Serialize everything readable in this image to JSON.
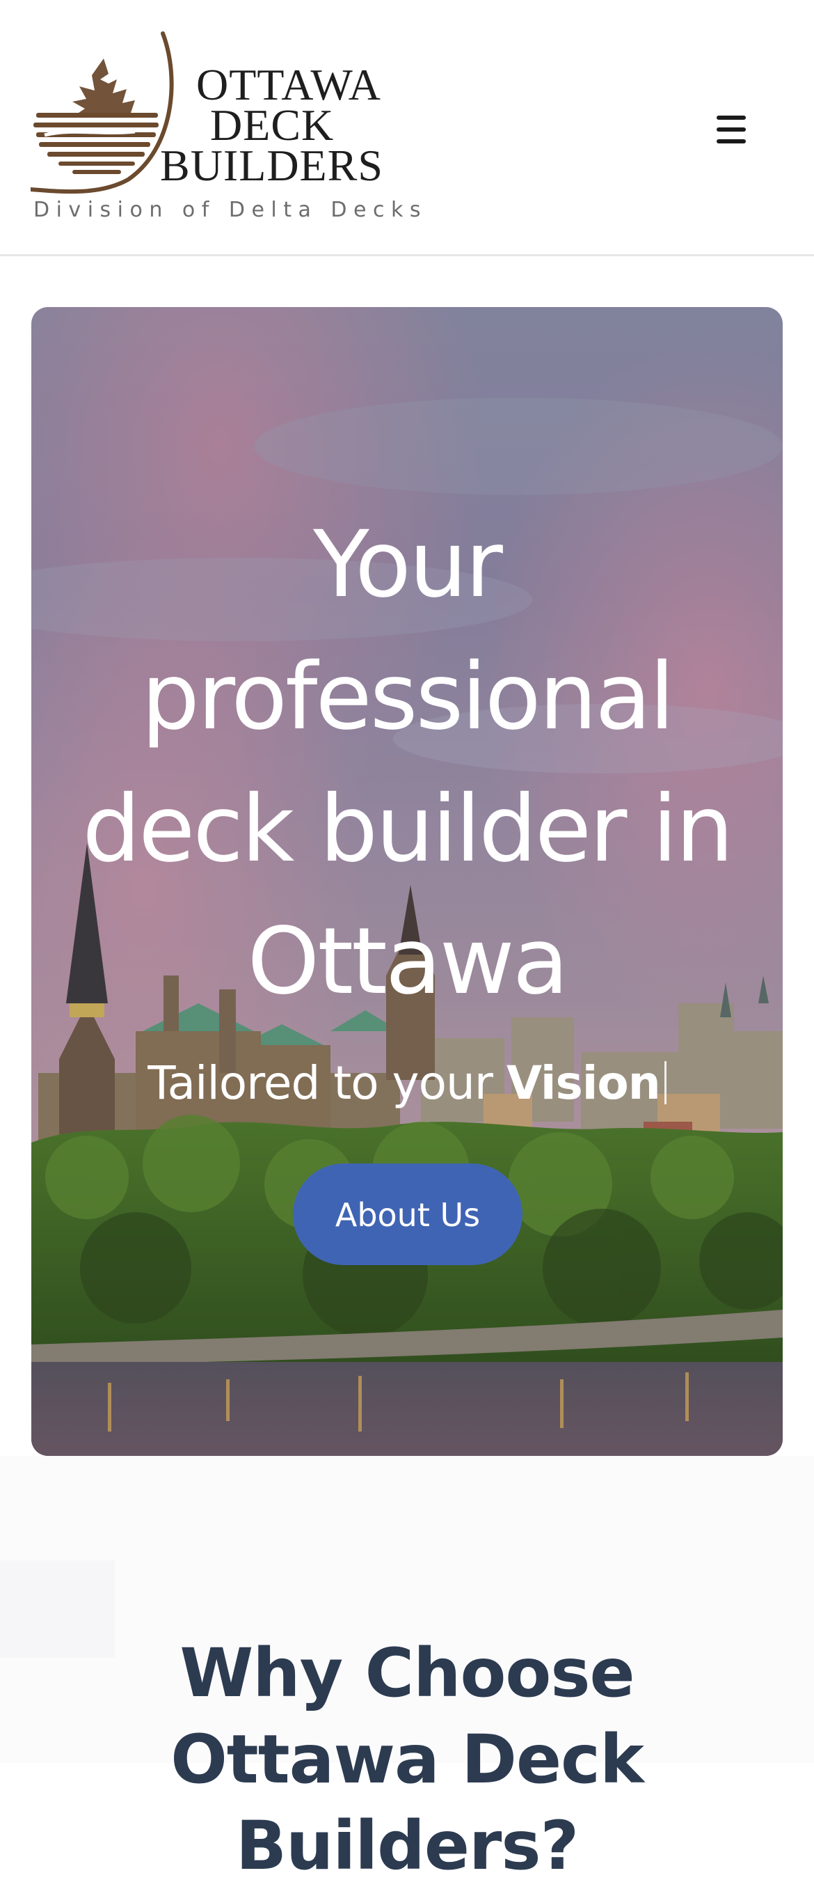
{
  "header": {
    "logo": {
      "line1": "OTTAWA",
      "line2": "DECK",
      "line3": "BUILDERS",
      "tagline": "Division of Delta Decks",
      "leaf_color": "#6b4a2e"
    },
    "menu_icon": "hamburger-icon"
  },
  "hero": {
    "title": "Your professional deck builder in Ottawa",
    "subtitle_prefix": "Tailored to your ",
    "subtitle_highlight": "Vision",
    "cta_label": "About Us",
    "cta_color": "#4064b4",
    "background": "ottawa-parliament-skyline-photo"
  },
  "why": {
    "title": "Why Choose Ottawa Deck Builders?"
  }
}
